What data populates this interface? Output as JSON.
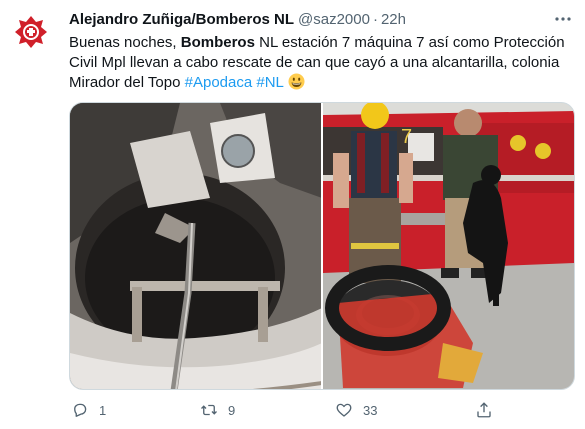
{
  "tweet": {
    "author_name": "Alejandro Zuñiga/Bomberos NL",
    "author_handle": "@saz2000",
    "separator": "·",
    "time": "22h",
    "text": {
      "p1": "Buenas noches, ",
      "bold": "Bomberos",
      "p2": " NL estación 7 máquina 7 así como Protección Civil Mpl llevan a cabo rescate de can que cayó a una alcantarilla, colonia Mirador del Topo ",
      "hashtag1": "#Apodaca",
      "hashtag2": "#NL",
      "emoji": "grinning-face-emoji"
    },
    "more_icon": "more-options-icon",
    "avatar_icon": "firefighter-emblem-icon",
    "photos": [
      {
        "name": "sewer-opening-photo"
      },
      {
        "name": "firefighters-with-dog-photo",
        "truck_number": "7"
      }
    ]
  },
  "actions": {
    "reply_count": "1",
    "retweet_count": "9",
    "like_count": "33",
    "reply_icon": "reply-icon",
    "retweet_icon": "retweet-icon",
    "like_icon": "heart-icon",
    "share_icon": "share-icon"
  },
  "colors": {
    "text": "#0f1419",
    "secondary": "#536471",
    "link": "#1d9bf0",
    "border": "#cfd9de",
    "brand_red": "#d0202a"
  }
}
